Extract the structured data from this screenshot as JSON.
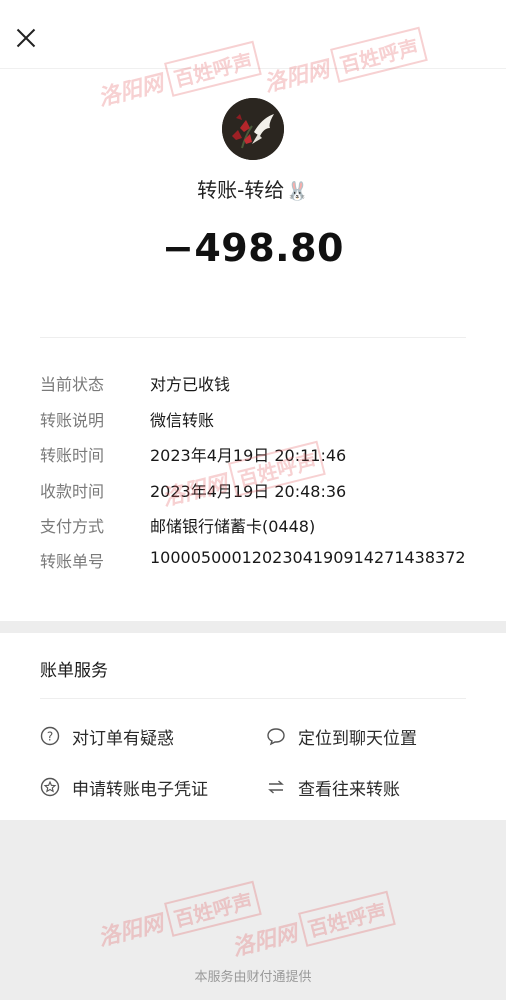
{
  "header": {
    "close_icon": "close-icon"
  },
  "payee": {
    "avatar_icon": "flower-bird-avatar",
    "title": "转账-转给",
    "emoji": "🐰"
  },
  "amount": "−498.80",
  "details": [
    {
      "label": "当前状态",
      "value": "对方已收钱"
    },
    {
      "label": "转账说明",
      "value": "微信转账"
    },
    {
      "label": "转账时间",
      "value": "2023年4月19日 20:11:46"
    },
    {
      "label": "收款时间",
      "value": "2023年4月19日 20:48:36"
    },
    {
      "label": "支付方式",
      "value": "邮储银行储蓄卡(0448)"
    },
    {
      "label": "转账单号",
      "value": "1000050001202304190914271438372"
    }
  ],
  "services": {
    "title": "账单服务",
    "items": [
      {
        "label": "对订单有疑惑",
        "icon": "question-circle-icon"
      },
      {
        "label": "定位到聊天位置",
        "icon": "chat-bubble-icon"
      },
      {
        "label": "申请转账电子凭证",
        "icon": "star-badge-icon"
      },
      {
        "label": "查看往来转账",
        "icon": "swap-arrows-icon"
      }
    ]
  },
  "footer": "本服务由财付通提供",
  "watermark": {
    "site": "洛阳网",
    "brand": "百姓呼声"
  },
  "colors": {
    "background": "#ededed",
    "card": "#ffffff",
    "watermark": "#e15a5f"
  }
}
